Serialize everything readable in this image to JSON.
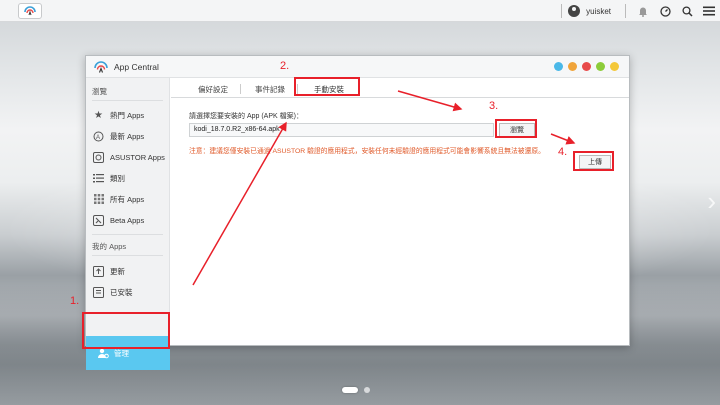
{
  "topbar": {
    "username": "yuisket"
  },
  "window": {
    "title": "App Central",
    "colors": [
      "#4ab8e8",
      "#f0a43a",
      "#e84a4a",
      "#8ccc3a",
      "#f4c83a"
    ]
  },
  "sidebar": {
    "section1": "瀏覽",
    "items": [
      {
        "label": "熱門 Apps",
        "icon": "star-icon"
      },
      {
        "label": "最新 Apps",
        "icon": "new-apps-icon"
      },
      {
        "label": "ASUSTOR Apps",
        "icon": "asustor-icon"
      },
      {
        "label": "類別",
        "icon": "list-icon"
      },
      {
        "label": "所有 Apps",
        "icon": "grid-icon"
      },
      {
        "label": "Beta Apps",
        "icon": "beta-icon"
      }
    ],
    "section2": "我的 Apps",
    "my_items": [
      {
        "label": "更新",
        "icon": "update-icon"
      },
      {
        "label": "已安裝",
        "icon": "installed-icon"
      }
    ],
    "active_item": "管理"
  },
  "tabs": [
    "偏好設定",
    "事件記錄",
    "手動安裝"
  ],
  "content": {
    "label": "請選擇您要安裝的 App (APK 檔案)：",
    "file_value": "kodi_18.7.0.R2_x86-64.apk",
    "browse": "瀏覽",
    "warning": "注意：建議您僅安裝已通過 ASUSTOR 驗證的應用程式，安裝任何未經驗證的應用程式可能會影響系統且無法被還原。",
    "upload": "上傳"
  },
  "annotations": [
    "1.",
    "2.",
    "3.",
    "4."
  ]
}
